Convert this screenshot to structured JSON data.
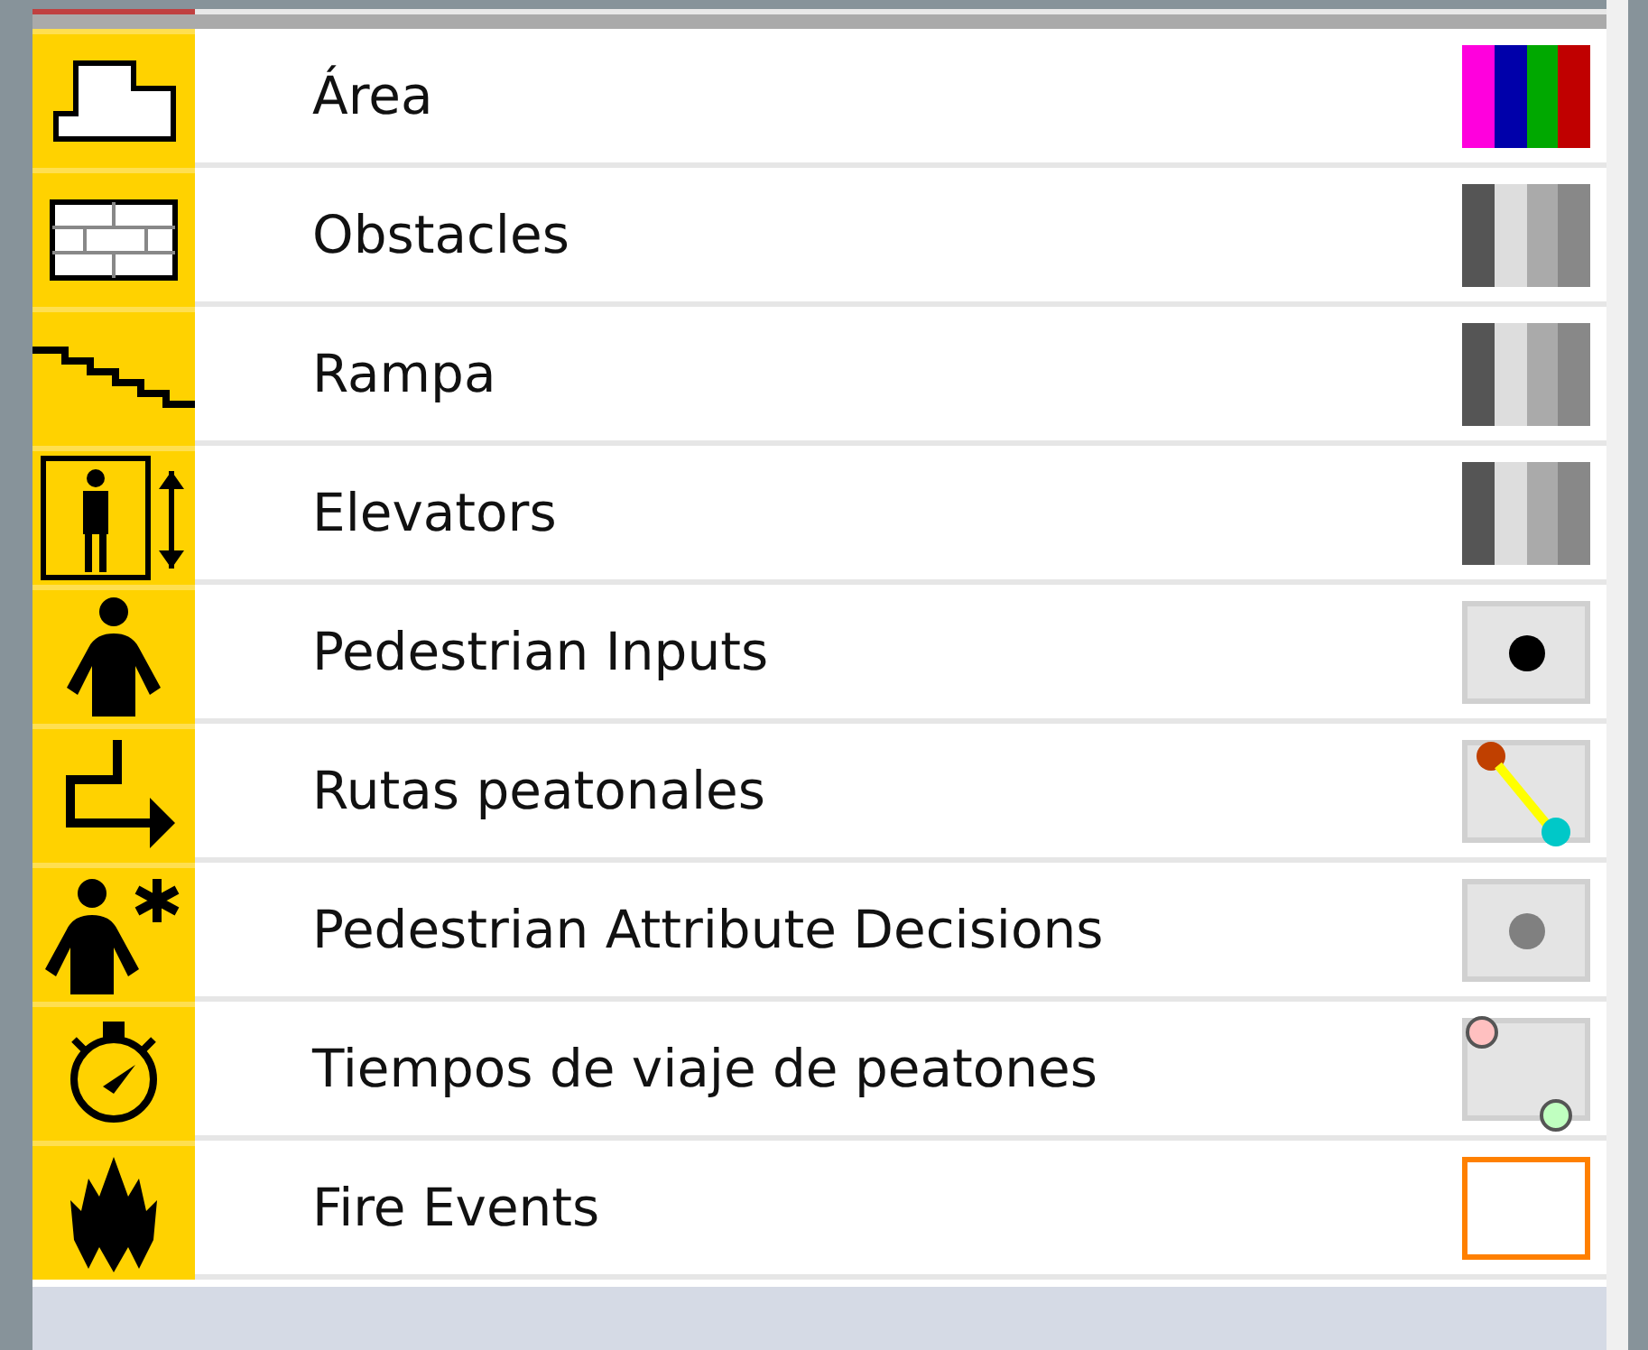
{
  "layers": [
    {
      "label": "Área",
      "swatch": {
        "kind": "stripes",
        "colors": [
          {
            "color": "#ff00dd"
          },
          {
            "color": "#0000aa"
          },
          {
            "color": "#00a800"
          },
          {
            "color": "#c00000"
          }
        ]
      }
    },
    {
      "label": "Obstacles",
      "swatch": {
        "kind": "stripes",
        "colors": [
          {
            "color": "#555555"
          },
          {
            "color": "#dddddd"
          },
          {
            "color": "#aaaaaa"
          },
          {
            "color": "#888888"
          }
        ]
      }
    },
    {
      "label": "Rampa",
      "swatch": {
        "kind": "stripes",
        "colors": [
          {
            "color": "#555555"
          },
          {
            "color": "#dddddd"
          },
          {
            "color": "#aaaaaa"
          },
          {
            "color": "#888888"
          }
        ]
      }
    },
    {
      "label": "Elevators",
      "swatch": {
        "kind": "stripes",
        "colors": [
          {
            "color": "#555555"
          },
          {
            "color": "#dddddd"
          },
          {
            "color": "#aaaaaa"
          },
          {
            "color": "#888888"
          }
        ]
      }
    },
    {
      "label": "Pedestrian Inputs",
      "swatch": {
        "kind": "dot",
        "colors": [
          {
            "color": "#000000"
          }
        ]
      }
    },
    {
      "label": "Rutas peatonales",
      "swatch": {
        "kind": "route",
        "colors": [
          {
            "color": "#c04000"
          },
          {
            "color": "#ffff00"
          },
          {
            "color": "#00c8c8"
          }
        ]
      }
    },
    {
      "label": "Pedestrian Attribute Decisions",
      "swatch": {
        "kind": "dot",
        "colors": [
          {
            "color": "#808080"
          }
        ]
      }
    },
    {
      "label": "Tiempos de viaje de peatones",
      "swatch": {
        "kind": "travel",
        "colors": [
          {
            "color": "#ffc0c0"
          },
          {
            "color": "#c0ffc0"
          }
        ]
      }
    },
    {
      "label": "Fire Events",
      "swatch": {
        "kind": "outline",
        "colors": [
          {
            "color": "#ff8000"
          }
        ]
      }
    }
  ]
}
